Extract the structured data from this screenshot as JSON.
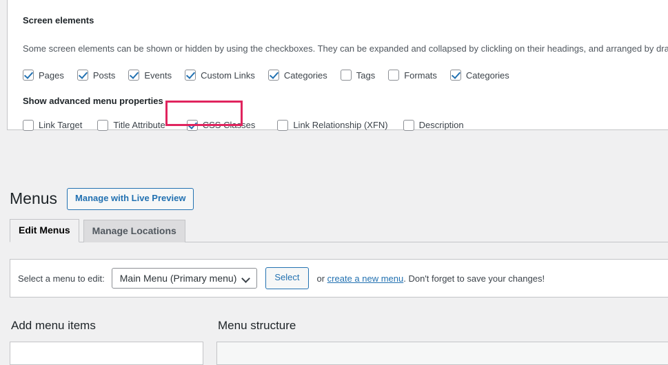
{
  "screen_options": {
    "legend": "Screen elements",
    "description": "Some screen elements can be shown or hidden by using the checkboxes. They can be expanded and collapsed by clickling on their headings, and arranged by dragg",
    "elements": [
      {
        "label": "Pages",
        "checked": true
      },
      {
        "label": "Posts",
        "checked": true
      },
      {
        "label": "Events",
        "checked": true
      },
      {
        "label": "Custom Links",
        "checked": true
      },
      {
        "label": "Categories",
        "checked": true
      },
      {
        "label": "Tags",
        "checked": false
      },
      {
        "label": "Formats",
        "checked": false
      },
      {
        "label": "Categories",
        "checked": true
      }
    ],
    "advanced_legend": "Show advanced menu properties",
    "advanced": [
      {
        "label": "Link Target",
        "checked": false
      },
      {
        "label": "Title Attribute",
        "checked": false
      },
      {
        "label": "CSS Classes",
        "checked": true
      },
      {
        "label": "Link Relationship (XFN)",
        "checked": false
      },
      {
        "label": "Description",
        "checked": false
      }
    ],
    "highlight_color": "#e0245e",
    "highlighted_item": "CSS Classes"
  },
  "menus": {
    "title": "Menus",
    "live_preview_label": "Manage with Live Preview",
    "tabs": [
      {
        "label": "Edit Menus",
        "active": true
      },
      {
        "label": "Manage Locations",
        "active": false
      }
    ],
    "select_row": {
      "label": "Select a menu to edit:",
      "selected_menu": "Main Menu (Primary menu)",
      "select_button": "Select",
      "or_text": "or ",
      "create_link": "create a new menu",
      "after_link_text": ". Don't forget to save your changes!"
    },
    "columns": {
      "left_heading": "Add menu items",
      "right_heading": "Menu structure"
    }
  },
  "colors": {
    "accent_blue": "#2271b1",
    "background": "#f0f0f1",
    "border": "#c3c4c7",
    "highlight": "#e0245e"
  }
}
